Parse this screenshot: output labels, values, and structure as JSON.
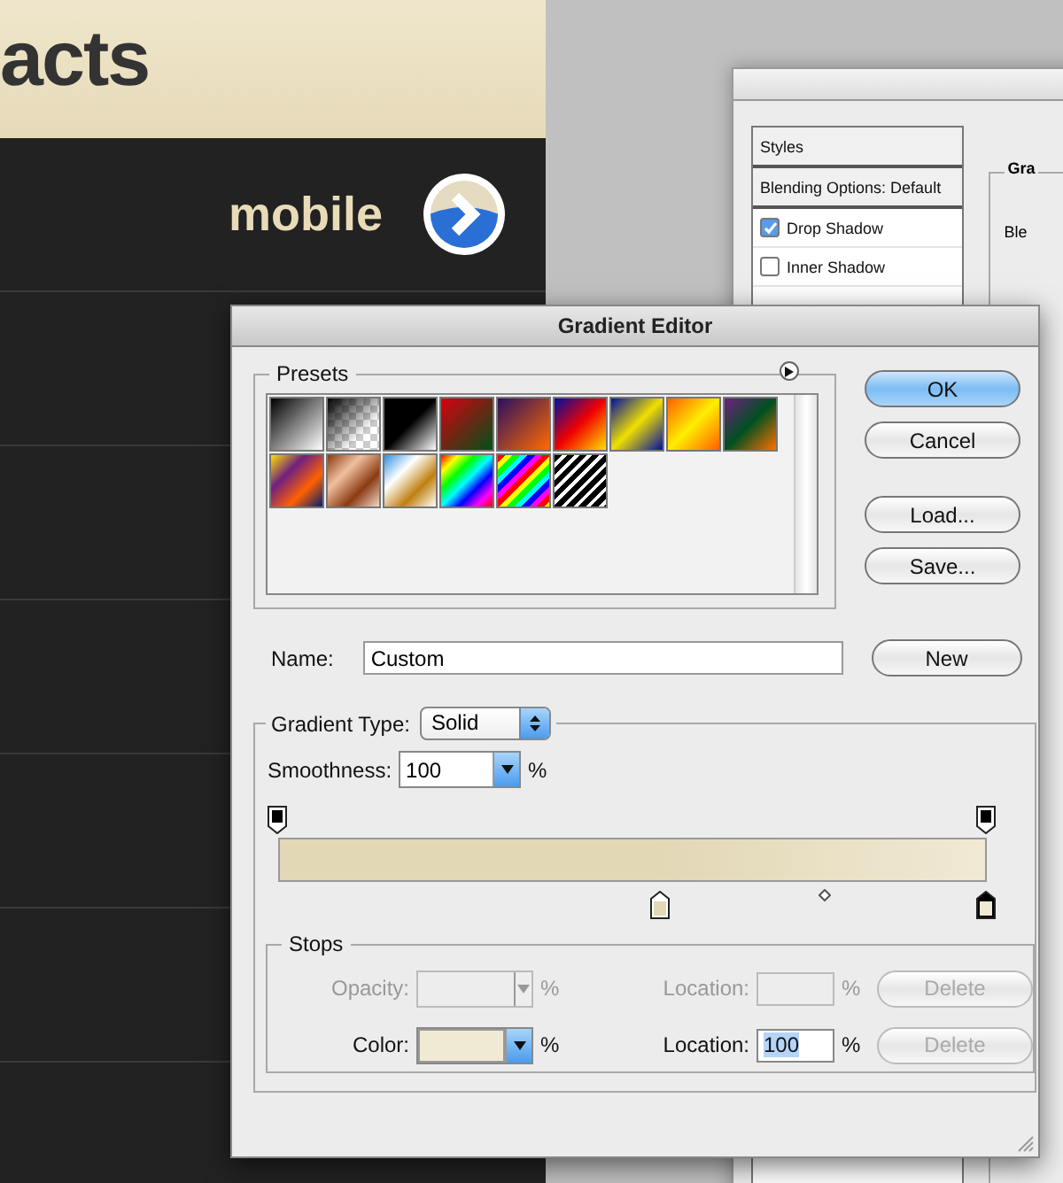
{
  "site": {
    "heading": "acts",
    "nav_label": "mobile"
  },
  "layer_style": {
    "styles": [
      {
        "label": "Styles",
        "kind": "header"
      },
      {
        "label": "Blending Options: Default",
        "kind": "header"
      },
      {
        "label": "Drop Shadow",
        "kind": "checkbox",
        "checked": true
      },
      {
        "label": "Inner Shadow",
        "kind": "checkbox",
        "checked": false
      }
    ],
    "group_legend": "Gra",
    "group_text": "Ble"
  },
  "gradient_editor": {
    "title": "Gradient Editor",
    "presets": {
      "legend": "Presets"
    },
    "buttons": [
      {
        "label": "OK",
        "default": true
      },
      {
        "label": "Cancel",
        "default": false
      },
      {
        "label": "Load...",
        "default": false
      },
      {
        "label": "Save...",
        "default": false
      }
    ],
    "name_label": "Name:",
    "name_value": "Custom",
    "new_button": "New",
    "type_label": "Gradient Type:",
    "type_value": "Solid",
    "smoothness_label": "Smoothness:",
    "smoothness_value": "100",
    "smoothness_unit": "%",
    "opacity_stops": [
      {
        "level": 0,
        "selected": false
      },
      {
        "level": 1,
        "selected": false
      }
    ],
    "color_stops": [
      {
        "level": 0.54,
        "color": "#e2d8b6",
        "selected": false
      },
      {
        "level": 1,
        "color": "#f0e9d4",
        "selected": true
      }
    ],
    "midpoint": {
      "level": 0.77
    },
    "stops": {
      "legend": "Stops",
      "rows": [
        {
          "label": "Opacity:",
          "unit": "%",
          "location_label": "Location:",
          "delete": "Delete",
          "disabled": true
        },
        {
          "label": "Color:",
          "color": "#f0e9d4",
          "unit": "%",
          "location_label": "Location:",
          "location_value": "100",
          "value_selected": true,
          "delete": "Delete",
          "disabled": false
        }
      ]
    }
  }
}
